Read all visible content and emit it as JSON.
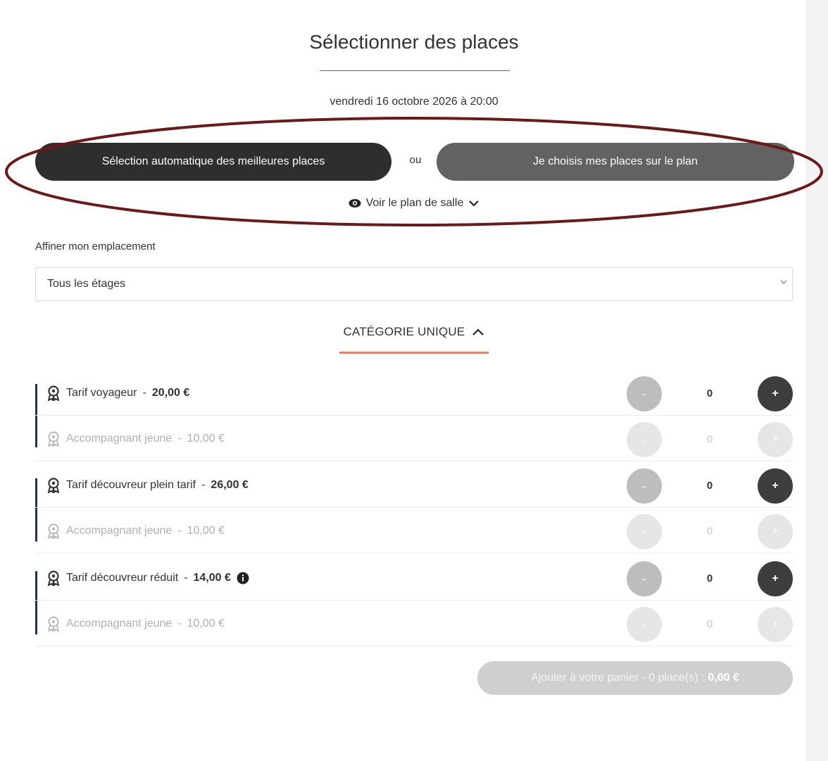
{
  "header": {
    "title": "Sélectionner des places",
    "date": "vendredi 16 octobre 2026 à 20:00"
  },
  "choice": {
    "auto_label": "Sélection automatique des meilleures places",
    "or_label": "ou",
    "plan_label": "Je choisis mes places sur le plan",
    "view_plan_label": "Voir le plan de salle"
  },
  "refine": {
    "label": "Affiner mon emplacement",
    "selected": "Tous les étages"
  },
  "category": {
    "title": "CATÉGORIE UNIQUE"
  },
  "tickets": [
    {
      "name": "Tarif voyageur",
      "sep": "-",
      "price": "20,00 €",
      "qty": "0",
      "minus": "-",
      "plus": "+",
      "enabled": true
    },
    {
      "name": "Accompagnant jeune",
      "sep": "-",
      "price": "10,00 €",
      "qty": "0",
      "minus": "-",
      "plus": "+",
      "enabled": false
    },
    {
      "name": "Tarif découvreur plein tarif",
      "sep": "-",
      "price": "26,00 €",
      "qty": "0",
      "minus": "-",
      "plus": "+",
      "enabled": true
    },
    {
      "name": "Accompagnant jeune",
      "sep": "-",
      "price": "10,00 €",
      "qty": "0",
      "minus": "-",
      "plus": "+",
      "enabled": false
    },
    {
      "name": "Tarif découvreur réduit",
      "sep": "-",
      "price": "14,00 €",
      "qty": "0",
      "minus": "-",
      "plus": "+",
      "enabled": true
    },
    {
      "name": "Accompagnant jeune",
      "sep": "-",
      "price": "10,00 €",
      "qty": "0",
      "minus": "-",
      "plus": "+",
      "enabled": false
    }
  ],
  "cart": {
    "label": "Ajouter à votre panier - 0 place(s) :",
    "amount": "0,00 €"
  },
  "colors": {
    "accent_underline": "#f08060",
    "annotation_ellipse": "#6b1a1a",
    "group_bar": "#22344a",
    "primary_button": "#2e2e2e",
    "secondary_button": "#626262"
  }
}
